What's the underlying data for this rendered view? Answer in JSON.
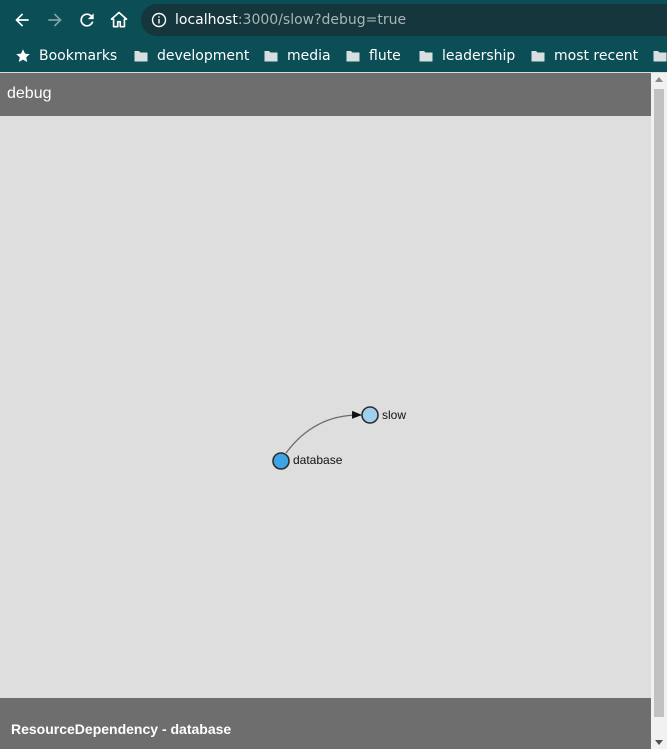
{
  "browser": {
    "url_host": "localhost",
    "url_rest": ":3000/slow?debug=true",
    "toolbar_color": "#0b4e56",
    "bookmarks": [
      {
        "label": "Bookmarks",
        "icon": "star-icon"
      },
      {
        "label": "development",
        "icon": "folder-icon"
      },
      {
        "label": "media",
        "icon": "folder-icon"
      },
      {
        "label": "flute",
        "icon": "folder-icon"
      },
      {
        "label": "leadership",
        "icon": "folder-icon"
      },
      {
        "label": "most recent",
        "icon": "folder-icon"
      }
    ]
  },
  "app": {
    "title": "debug",
    "footer_text": "ResourceDependency - database",
    "graph": {
      "nodes": [
        {
          "id": "slow",
          "label": "slow",
          "color": "#9fd0f0"
        },
        {
          "id": "database",
          "label": "database",
          "color": "#3fa4e6"
        }
      ],
      "edges": [
        {
          "from": "database",
          "to": "slow"
        }
      ]
    }
  }
}
